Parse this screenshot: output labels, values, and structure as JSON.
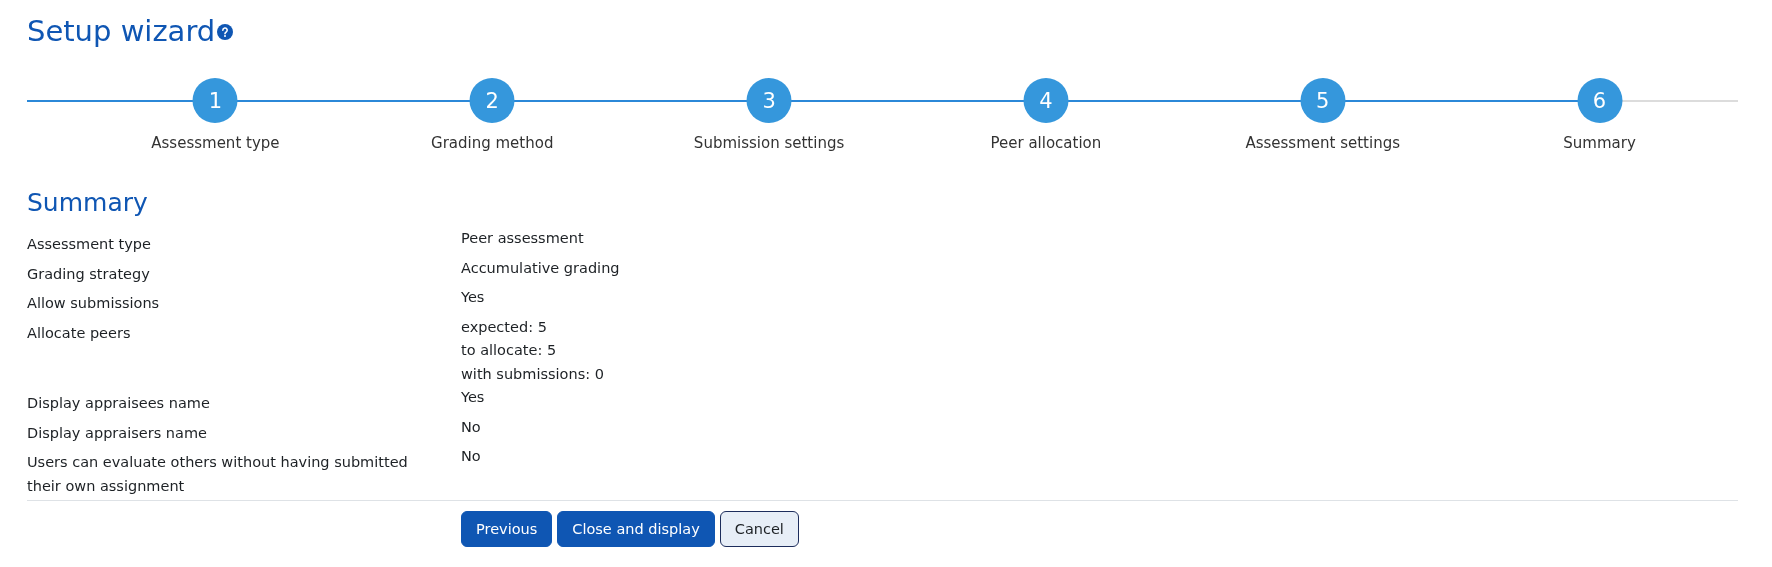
{
  "title": "Setup wizard",
  "steps": [
    {
      "number": "1",
      "label": "Assessment type",
      "selected": false
    },
    {
      "number": "2",
      "label": "Grading method",
      "selected": false
    },
    {
      "number": "3",
      "label": "Submission settings",
      "selected": false
    },
    {
      "number": "4",
      "label": "Peer allocation",
      "selected": false
    },
    {
      "number": "5",
      "label": "Assessment settings",
      "selected": false
    },
    {
      "number": "6",
      "label": "Summary",
      "selected": true
    }
  ],
  "section_title": "Summary",
  "rows": [
    {
      "label": "Assessment type",
      "values": [
        "Peer assessment"
      ]
    },
    {
      "label": "Grading strategy",
      "values": [
        "Accumulative grading"
      ]
    },
    {
      "label": "Allow submissions",
      "values": [
        "Yes"
      ]
    },
    {
      "label": "Allocate peers",
      "values": [
        "expected: 5",
        "to allocate: 5",
        "with submissions: 0"
      ]
    },
    {
      "label": "Display appraisees name",
      "values": [
        "Yes"
      ]
    },
    {
      "label": "Display appraisers name",
      "values": [
        "No"
      ]
    },
    {
      "label": "Users can evaluate others without having submitted their own assignment",
      "values": [
        "No"
      ]
    }
  ],
  "buttons": [
    {
      "label": "Previous",
      "kind": "primary"
    },
    {
      "label": "Close and display",
      "kind": "primary"
    },
    {
      "label": "Cancel",
      "kind": "secondary"
    }
  ]
}
